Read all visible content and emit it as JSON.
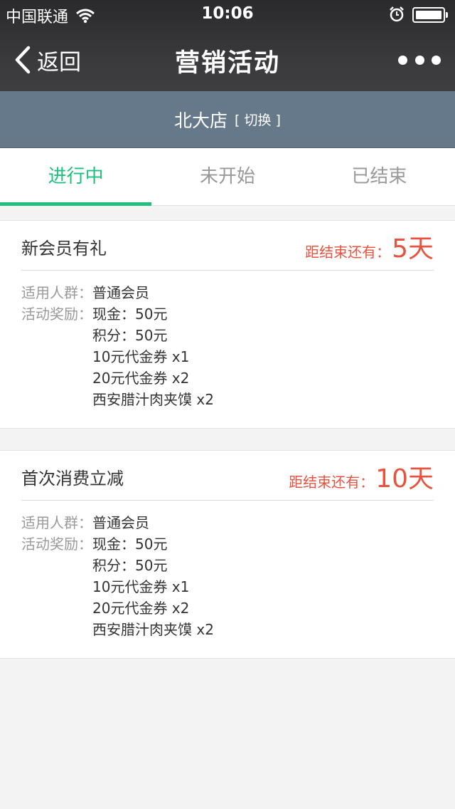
{
  "status_bar": {
    "carrier": "中国联通",
    "time": "10:06",
    "icons": [
      "wifi-icon",
      "alarm-icon",
      "battery-icon"
    ]
  },
  "nav": {
    "back_label": "返回",
    "title": "营销活动",
    "more_icon": "more-icon"
  },
  "store": {
    "name": "北大店",
    "switch_label": "[ 切换 ]"
  },
  "tabs": [
    {
      "label": "进行中",
      "active": true
    },
    {
      "label": "未开始",
      "active": false
    },
    {
      "label": "已结束",
      "active": false
    }
  ],
  "activities": [
    {
      "title": "新会员有礼",
      "countdown_label": "距结束还有：",
      "countdown_value": "5天",
      "audience_label": "适用人群：",
      "audience_value": "普通会员",
      "rewards_label": "活动奖励：",
      "rewards": [
        "现金：50元",
        "积分：50元",
        "10元代金券 x1",
        "20元代金券 x2",
        "西安腊汁肉夹馍 x2"
      ]
    },
    {
      "title": "首次消费立减",
      "countdown_label": "距结束还有：",
      "countdown_value": "10天",
      "audience_label": "适用人群：",
      "audience_value": "普通会员",
      "rewards_label": "活动奖励：",
      "rewards": [
        "现金：50元",
        "积分：50元",
        "10元代金券 x1",
        "20元代金券 x2",
        "西安腊汁肉夹馍 x2"
      ]
    }
  ],
  "colors": {
    "accent_green": "#1fbf7e",
    "countdown_red": "#e8523f",
    "store_bar": "#66798a"
  }
}
